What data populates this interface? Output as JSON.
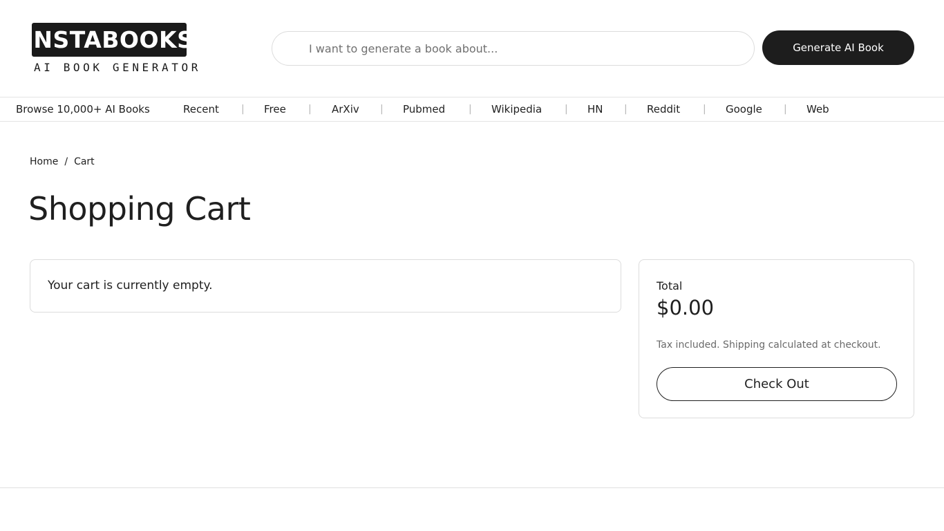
{
  "header": {
    "logo": {
      "title": "INSTABOOKS",
      "subtitle": "AI BOOK GENERATOR"
    },
    "search": {
      "placeholder": "I want to generate a book about...",
      "value": ""
    },
    "generate_button": "Generate AI Book"
  },
  "nav": {
    "browse": "Browse 10,000+ AI Books",
    "separator": "|",
    "items": [
      "Recent",
      "Free",
      "ArXiv",
      "Pubmed",
      "Wikipedia",
      "HN",
      "Reddit",
      "Google",
      "Web"
    ]
  },
  "breadcrumb": {
    "home": "Home",
    "separator": "/",
    "current": "Cart"
  },
  "page_title": "Shopping Cart",
  "cart": {
    "empty_message": "Your cart is currently empty."
  },
  "summary": {
    "total_label": "Total",
    "total_amount": "$0.00",
    "tax_note": "Tax included. Shipping calculated at checkout.",
    "checkout_button": "Check Out"
  },
  "colors": {
    "primary_dark": "#1d1d1d",
    "border": "#dcdcdc",
    "muted_text": "#6a6a6a",
    "background": "#ffffff"
  }
}
